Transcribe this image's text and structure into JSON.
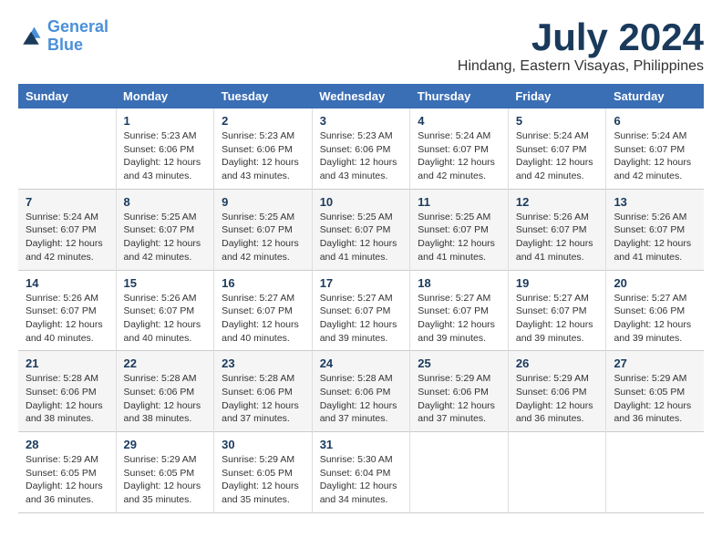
{
  "logo": {
    "line1": "General",
    "line2": "Blue"
  },
  "title": "July 2024",
  "subtitle": "Hindang, Eastern Visayas, Philippines",
  "header": {
    "days": [
      "Sunday",
      "Monday",
      "Tuesday",
      "Wednesday",
      "Thursday",
      "Friday",
      "Saturday"
    ]
  },
  "weeks": [
    [
      {
        "num": "",
        "info": ""
      },
      {
        "num": "1",
        "info": "Sunrise: 5:23 AM\nSunset: 6:06 PM\nDaylight: 12 hours\nand 43 minutes."
      },
      {
        "num": "2",
        "info": "Sunrise: 5:23 AM\nSunset: 6:06 PM\nDaylight: 12 hours\nand 43 minutes."
      },
      {
        "num": "3",
        "info": "Sunrise: 5:23 AM\nSunset: 6:06 PM\nDaylight: 12 hours\nand 43 minutes."
      },
      {
        "num": "4",
        "info": "Sunrise: 5:24 AM\nSunset: 6:07 PM\nDaylight: 12 hours\nand 42 minutes."
      },
      {
        "num": "5",
        "info": "Sunrise: 5:24 AM\nSunset: 6:07 PM\nDaylight: 12 hours\nand 42 minutes."
      },
      {
        "num": "6",
        "info": "Sunrise: 5:24 AM\nSunset: 6:07 PM\nDaylight: 12 hours\nand 42 minutes."
      }
    ],
    [
      {
        "num": "7",
        "info": "Sunrise: 5:24 AM\nSunset: 6:07 PM\nDaylight: 12 hours\nand 42 minutes."
      },
      {
        "num": "8",
        "info": "Sunrise: 5:25 AM\nSunset: 6:07 PM\nDaylight: 12 hours\nand 42 minutes."
      },
      {
        "num": "9",
        "info": "Sunrise: 5:25 AM\nSunset: 6:07 PM\nDaylight: 12 hours\nand 42 minutes."
      },
      {
        "num": "10",
        "info": "Sunrise: 5:25 AM\nSunset: 6:07 PM\nDaylight: 12 hours\nand 41 minutes."
      },
      {
        "num": "11",
        "info": "Sunrise: 5:25 AM\nSunset: 6:07 PM\nDaylight: 12 hours\nand 41 minutes."
      },
      {
        "num": "12",
        "info": "Sunrise: 5:26 AM\nSunset: 6:07 PM\nDaylight: 12 hours\nand 41 minutes."
      },
      {
        "num": "13",
        "info": "Sunrise: 5:26 AM\nSunset: 6:07 PM\nDaylight: 12 hours\nand 41 minutes."
      }
    ],
    [
      {
        "num": "14",
        "info": "Sunrise: 5:26 AM\nSunset: 6:07 PM\nDaylight: 12 hours\nand 40 minutes."
      },
      {
        "num": "15",
        "info": "Sunrise: 5:26 AM\nSunset: 6:07 PM\nDaylight: 12 hours\nand 40 minutes."
      },
      {
        "num": "16",
        "info": "Sunrise: 5:27 AM\nSunset: 6:07 PM\nDaylight: 12 hours\nand 40 minutes."
      },
      {
        "num": "17",
        "info": "Sunrise: 5:27 AM\nSunset: 6:07 PM\nDaylight: 12 hours\nand 39 minutes."
      },
      {
        "num": "18",
        "info": "Sunrise: 5:27 AM\nSunset: 6:07 PM\nDaylight: 12 hours\nand 39 minutes."
      },
      {
        "num": "19",
        "info": "Sunrise: 5:27 AM\nSunset: 6:07 PM\nDaylight: 12 hours\nand 39 minutes."
      },
      {
        "num": "20",
        "info": "Sunrise: 5:27 AM\nSunset: 6:06 PM\nDaylight: 12 hours\nand 39 minutes."
      }
    ],
    [
      {
        "num": "21",
        "info": "Sunrise: 5:28 AM\nSunset: 6:06 PM\nDaylight: 12 hours\nand 38 minutes."
      },
      {
        "num": "22",
        "info": "Sunrise: 5:28 AM\nSunset: 6:06 PM\nDaylight: 12 hours\nand 38 minutes."
      },
      {
        "num": "23",
        "info": "Sunrise: 5:28 AM\nSunset: 6:06 PM\nDaylight: 12 hours\nand 37 minutes."
      },
      {
        "num": "24",
        "info": "Sunrise: 5:28 AM\nSunset: 6:06 PM\nDaylight: 12 hours\nand 37 minutes."
      },
      {
        "num": "25",
        "info": "Sunrise: 5:29 AM\nSunset: 6:06 PM\nDaylight: 12 hours\nand 37 minutes."
      },
      {
        "num": "26",
        "info": "Sunrise: 5:29 AM\nSunset: 6:06 PM\nDaylight: 12 hours\nand 36 minutes."
      },
      {
        "num": "27",
        "info": "Sunrise: 5:29 AM\nSunset: 6:05 PM\nDaylight: 12 hours\nand 36 minutes."
      }
    ],
    [
      {
        "num": "28",
        "info": "Sunrise: 5:29 AM\nSunset: 6:05 PM\nDaylight: 12 hours\nand 36 minutes."
      },
      {
        "num": "29",
        "info": "Sunrise: 5:29 AM\nSunset: 6:05 PM\nDaylight: 12 hours\nand 35 minutes."
      },
      {
        "num": "30",
        "info": "Sunrise: 5:29 AM\nSunset: 6:05 PM\nDaylight: 12 hours\nand 35 minutes."
      },
      {
        "num": "31",
        "info": "Sunrise: 5:30 AM\nSunset: 6:04 PM\nDaylight: 12 hours\nand 34 minutes."
      },
      {
        "num": "",
        "info": ""
      },
      {
        "num": "",
        "info": ""
      },
      {
        "num": "",
        "info": ""
      }
    ]
  ]
}
